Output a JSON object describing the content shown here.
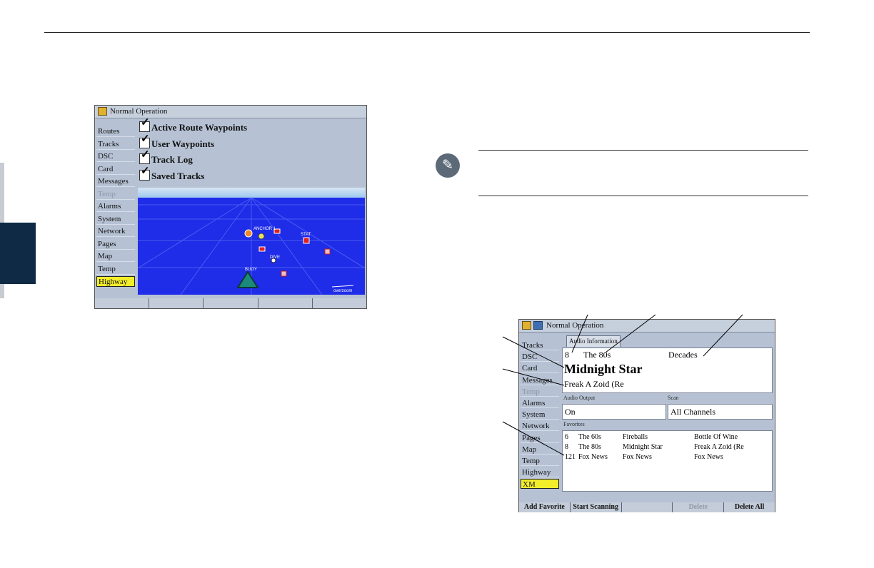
{
  "screen1": {
    "title": "Normal Operation",
    "title_icon": "folder-icon",
    "menu": [
      {
        "label": "Routes",
        "state": "normal"
      },
      {
        "label": "Tracks",
        "state": "normal"
      },
      {
        "label": "DSC",
        "state": "normal"
      },
      {
        "label": "Card",
        "state": "normal"
      },
      {
        "label": "Messages",
        "state": "normal"
      },
      {
        "label": "Temp",
        "state": "dim"
      },
      {
        "label": "Alarms",
        "state": "normal"
      },
      {
        "label": "System",
        "state": "normal"
      },
      {
        "label": "Network",
        "state": "normal"
      },
      {
        "label": "Pages",
        "state": "normal"
      },
      {
        "label": "Map",
        "state": "normal"
      },
      {
        "label": "Temp",
        "state": "normal"
      },
      {
        "label": "Highway",
        "state": "selected"
      }
    ],
    "checks": [
      {
        "label": "Active Route Waypoints",
        "checked": true
      },
      {
        "label": "User Waypoints",
        "checked": true
      },
      {
        "label": "Track Log",
        "checked": true
      },
      {
        "label": "Saved Tracks",
        "checked": true
      }
    ],
    "highway": {
      "waypoint_labels": [
        "ANCHOR 1",
        "DIVE",
        "BUOY",
        "STAT"
      ],
      "scale_label": "overzoom"
    },
    "softkeys": [
      "",
      "",
      "",
      "",
      ""
    ]
  },
  "screen2": {
    "title": "Normal Operation",
    "title_icons": [
      "folder-icon",
      "xm-icon"
    ],
    "tab_label": "Audio Information",
    "menu": [
      {
        "label": "Tracks",
        "state": "normal"
      },
      {
        "label": "DSC",
        "state": "normal"
      },
      {
        "label": "Card",
        "state": "normal"
      },
      {
        "label": "Messages",
        "state": "normal"
      },
      {
        "label": "Temp",
        "state": "dim"
      },
      {
        "label": "Alarms",
        "state": "normal"
      },
      {
        "label": "System",
        "state": "normal"
      },
      {
        "label": "Network",
        "state": "normal"
      },
      {
        "label": "Pages",
        "state": "normal"
      },
      {
        "label": "Map",
        "state": "normal"
      },
      {
        "label": "Temp",
        "state": "normal"
      },
      {
        "label": "Highway",
        "state": "normal"
      },
      {
        "label": "XM",
        "state": "selected"
      }
    ],
    "audio_info": {
      "channel_number": "8",
      "channel_name": "The 80s",
      "category": "Decades",
      "artist": "Midnight Star",
      "song": "Freak A Zoid (Re"
    },
    "audio_output": {
      "label": "Audio Output",
      "value": "On"
    },
    "scan": {
      "label": "Scan",
      "value": "All Channels"
    },
    "favorites": {
      "label": "Favorites",
      "rows": [
        {
          "ch": "6",
          "name": "The 60s",
          "artist": "Fireballs",
          "song": "Bottle Of Wine"
        },
        {
          "ch": "8",
          "name": "The 80s",
          "artist": "Midnight Star",
          "song": "Freak A Zoid (Re"
        },
        {
          "ch": "121",
          "name": "Fox News",
          "artist": "Fox News",
          "song": "Fox News"
        }
      ]
    },
    "softkeys": [
      {
        "label": "Add Favorite",
        "state": "normal"
      },
      {
        "label": "Start Scanning",
        "state": "normal"
      },
      {
        "label": "",
        "state": "normal"
      },
      {
        "label": "Delete",
        "state": "dim"
      },
      {
        "label": "Delete All",
        "state": "normal"
      }
    ]
  },
  "note": {
    "icon": "pencil-note-icon"
  },
  "colors": {
    "highway_blue": "#1f2ce8",
    "selected": "#f3ee2a",
    "sidebar_tab": "#0e2a44"
  }
}
